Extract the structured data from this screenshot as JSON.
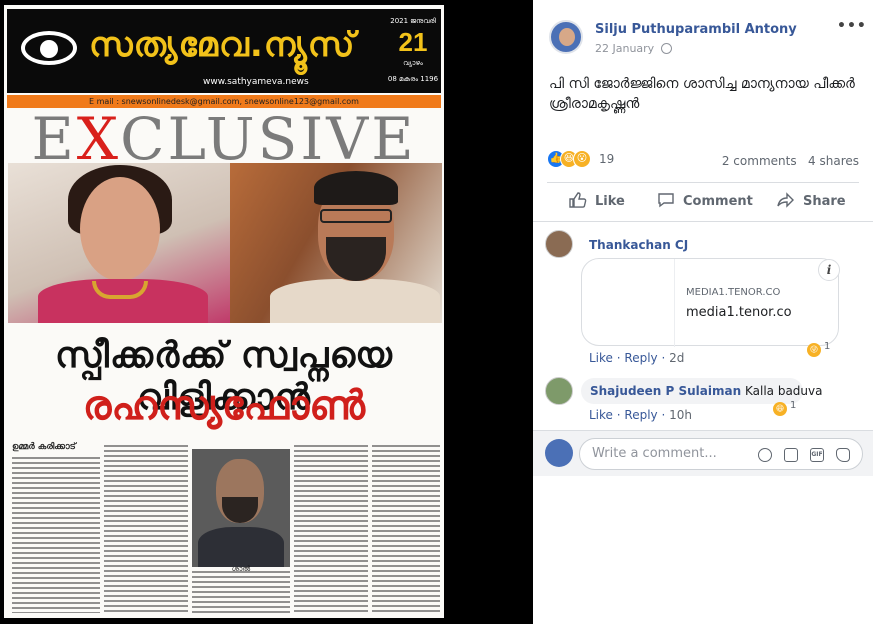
{
  "newspaper": {
    "masthead_title": "സത്യമേവ.ന്യൂസ്",
    "masthead_url": "www.sathyameva.news",
    "date_year": "2021 ജനുവരി",
    "date_day": "21",
    "date_weekday": "വ്യാഴം",
    "date_era": "08 മകരം 1196",
    "email_line": "E mail : snewsonlinedesk@gmail.com,  snewsonline123@gmail.com",
    "exclusive_pre": "E",
    "exclusive_x": "X",
    "exclusive_post": "CLUSIVE",
    "headline_1": "സ്പീക്കർക്ക് സ്വപ്നയെ വിളിക്കാൻ",
    "headline_2": "രഹസ്യഫോൺ",
    "byline": "ഉമ്മർ കരിക്കാട്",
    "inset_caption": "ശാൽ"
  },
  "post": {
    "author": "Silju Puthuparambil Antony",
    "date": "22 January",
    "text": "പി സി ജോർജ്ജിനെ ശാസിച്ച മാന്യനായ പീക്കർ ശ്രീരാമകൃഷ്ണൻ",
    "reaction_count": "19",
    "comments_count": "2 comments",
    "shares_count": "4 shares"
  },
  "actions": {
    "like": "Like",
    "comment": "Comment",
    "share": "Share"
  },
  "comments": [
    {
      "author": "Thankachan CJ",
      "link_domain": "MEDIA1.TENOR.CO",
      "link_title": "media1.tenor.co",
      "reaction_count": "1",
      "like_label": "Like",
      "reply_label": "Reply",
      "time": "2d"
    },
    {
      "author": "Shajudeen P Sulaiman",
      "text": "Kalla baduva",
      "reaction_count": "1",
      "like_label": "Like",
      "reply_label": "Reply",
      "time": "10h"
    }
  ],
  "composer": {
    "placeholder": "Write a comment..."
  },
  "icons": {
    "globe": "globe-icon",
    "more": "more-options-icon",
    "info": "info-icon"
  },
  "colors": {
    "fb_blue": "#385898",
    "headline_red": "#d0201b",
    "masthead_yellow": "#f2c21a"
  }
}
